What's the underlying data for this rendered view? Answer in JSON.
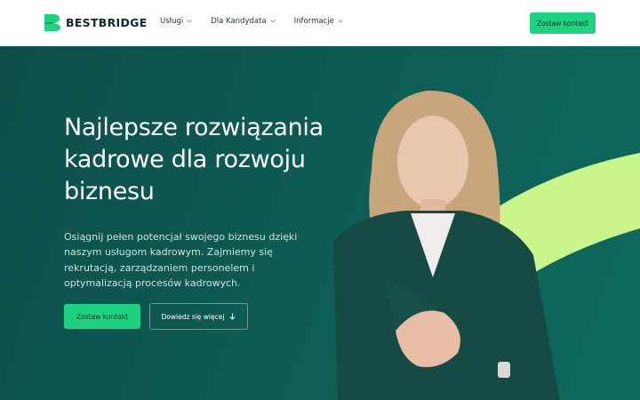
{
  "header": {
    "brand": "BESTBRIDGE",
    "nav": [
      {
        "label": "Usługi"
      },
      {
        "label": "Dla Kandydata"
      },
      {
        "label": "Informacje"
      }
    ],
    "cta_label": "Zostaw kontakt"
  },
  "hero": {
    "headline": "Najlepsze rozwiązania kadrowe dla rozwoju biznesu",
    "subtext": "Osiągnij pełen potencjał swojego biznesu dzięki naszym usługom kadrowym. Zajmiemy się rekrutacją, zarządzaniem personelem i optymalizacją procesów kadrowych.",
    "primary_button": "Zostaw kontakt",
    "secondary_button": "Dowiedz się więcej",
    "image_subject": "woman-in-green-blazer-offering-handshake"
  },
  "colors": {
    "brand_green": "#1ed37f",
    "hero_bg": "#0d5b53",
    "accent_lime": "#c9f58a",
    "text_dark": "#0c2a2a"
  },
  "icons": [
    "logo-mark-icon",
    "chevron-down-icon",
    "arrow-down-icon"
  ]
}
